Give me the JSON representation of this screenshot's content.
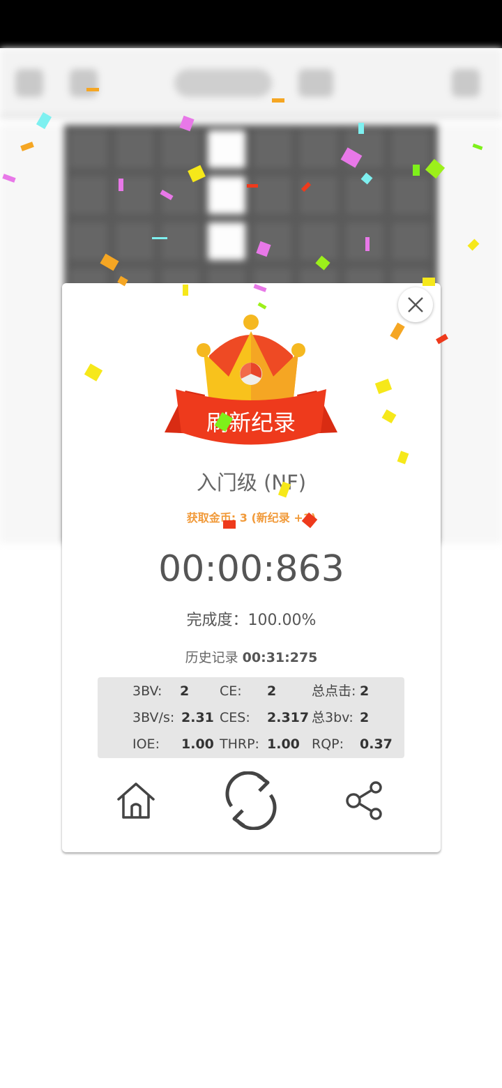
{
  "dialog": {
    "banner_title": "刷新纪录",
    "level": "入门级 (NF)",
    "coins_text": "获取金币: 3 (新纪录 +1)",
    "time": "00:00:863",
    "completion": "完成度：100.00%",
    "history_label": "历史记录",
    "history_time": "00:31:275",
    "stats": {
      "bv_label": "3BV:",
      "bv_value": "2",
      "ce_label": "CE:",
      "ce_value": "2",
      "clicks_label": "总点击:",
      "clicks_value": "2",
      "bvs_label": "3BV/s:",
      "bvs_value": "2.31",
      "ces_label": "CES:",
      "ces_value": "2.317",
      "total3bv_label": "总3bv:",
      "total3bv_value": "2",
      "ioe_label": "IOE:",
      "ioe_value": "1.00",
      "thrp_label": "THRP:",
      "thrp_value": "1.00",
      "rqp_label": "RQP:",
      "rqp_value": "0.37"
    },
    "buttons": [
      "home-icon",
      "restart-icon",
      "share-icon"
    ]
  },
  "colors": {
    "banner_red": "#ee3a1c",
    "crown_gold": "#f8c21c",
    "coins_orange": "#f19a3a",
    "stats_bg": "#e6e6e6"
  }
}
